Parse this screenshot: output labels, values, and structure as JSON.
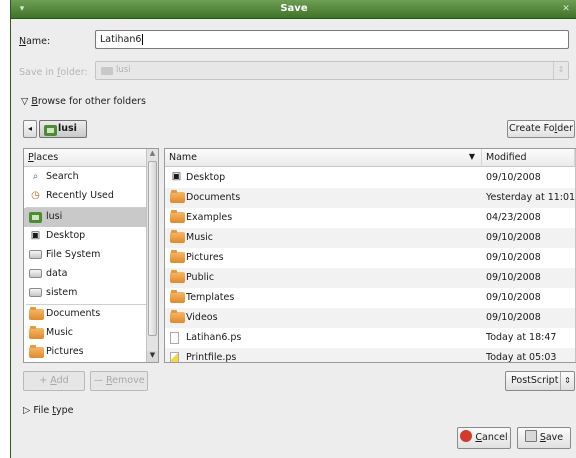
{
  "window": {
    "title": "Save",
    "menu_glyph": "▾",
    "close_glyph": "✕"
  },
  "name_row": {
    "label_prefix": "N",
    "label_rest": "ame:",
    "value": "Latihan6"
  },
  "save_in_row": {
    "label_prefix": "Save in ",
    "label_u": "f",
    "label_rest": "older:",
    "value": "lusi",
    "arrow": "⇕"
  },
  "browse": {
    "arrow": "▽",
    "u": "B",
    "rest": "rowse for other folders"
  },
  "pathbar": {
    "left_arrow": "◂",
    "current": "lusi"
  },
  "create_folder": {
    "prefix": "Create Fo",
    "u": "l",
    "rest": "der"
  },
  "places": {
    "header_u": "P",
    "header_rest": "laces",
    "items": [
      {
        "label": "Search",
        "icon": "search-icon"
      },
      {
        "label": "Recently Used",
        "icon": "clock-icon"
      },
      {
        "label": "lusi",
        "icon": "home-folder-icon",
        "selected": true
      },
      {
        "label": "Desktop",
        "icon": "desktop-icon"
      },
      {
        "label": "File System",
        "icon": "drive-icon"
      },
      {
        "label": "data",
        "icon": "drive-icon"
      },
      {
        "label": "sistem",
        "icon": "drive-icon"
      },
      {
        "label": "Documents",
        "icon": "folder-icon"
      },
      {
        "label": "Music",
        "icon": "folder-icon"
      },
      {
        "label": "Pictures",
        "icon": "folder-icon"
      }
    ]
  },
  "files": {
    "col_name": "Name",
    "col_modified": "Modified",
    "sort_glyph": "▼",
    "rows": [
      {
        "name": "Desktop",
        "modified": "09/10/2008",
        "icon": "desktop-icon"
      },
      {
        "name": "Documents",
        "modified": "Yesterday at 11:01",
        "icon": "folder-icon"
      },
      {
        "name": "Examples",
        "modified": "04/23/2008",
        "icon": "folder-icon"
      },
      {
        "name": "Music",
        "modified": "09/10/2008",
        "icon": "folder-icon"
      },
      {
        "name": "Pictures",
        "modified": "09/10/2008",
        "icon": "folder-icon"
      },
      {
        "name": "Public",
        "modified": "09/10/2008",
        "icon": "folder-icon"
      },
      {
        "name": "Templates",
        "modified": "09/10/2008",
        "icon": "folder-icon"
      },
      {
        "name": "Videos",
        "modified": "09/10/2008",
        "icon": "folder-icon"
      },
      {
        "name": "Latihan6.ps",
        "modified": "Today at 18:47",
        "icon": "document-icon"
      },
      {
        "name": "Printfile.ps",
        "modified": "Today at 05:03",
        "icon": "postscript-icon"
      }
    ]
  },
  "add_button": {
    "u": "A",
    "rest": "dd",
    "glyph": "+"
  },
  "remove_button": {
    "u": "R",
    "rest": "emove",
    "glyph": "—"
  },
  "filter": {
    "value": "PostScript",
    "arrow": "⇕"
  },
  "file_type": {
    "arrow": "▷",
    "prefix": "File ",
    "u": "t",
    "rest": "ype"
  },
  "cancel_button": {
    "u": "C",
    "rest": "ancel",
    "color": "#d23a2a"
  },
  "save_button": {
    "u": "S",
    "rest": "ave"
  },
  "colors": {
    "titlebar": "#4f8533",
    "selection": "#c9c9c9",
    "folder": "#e8922e"
  }
}
